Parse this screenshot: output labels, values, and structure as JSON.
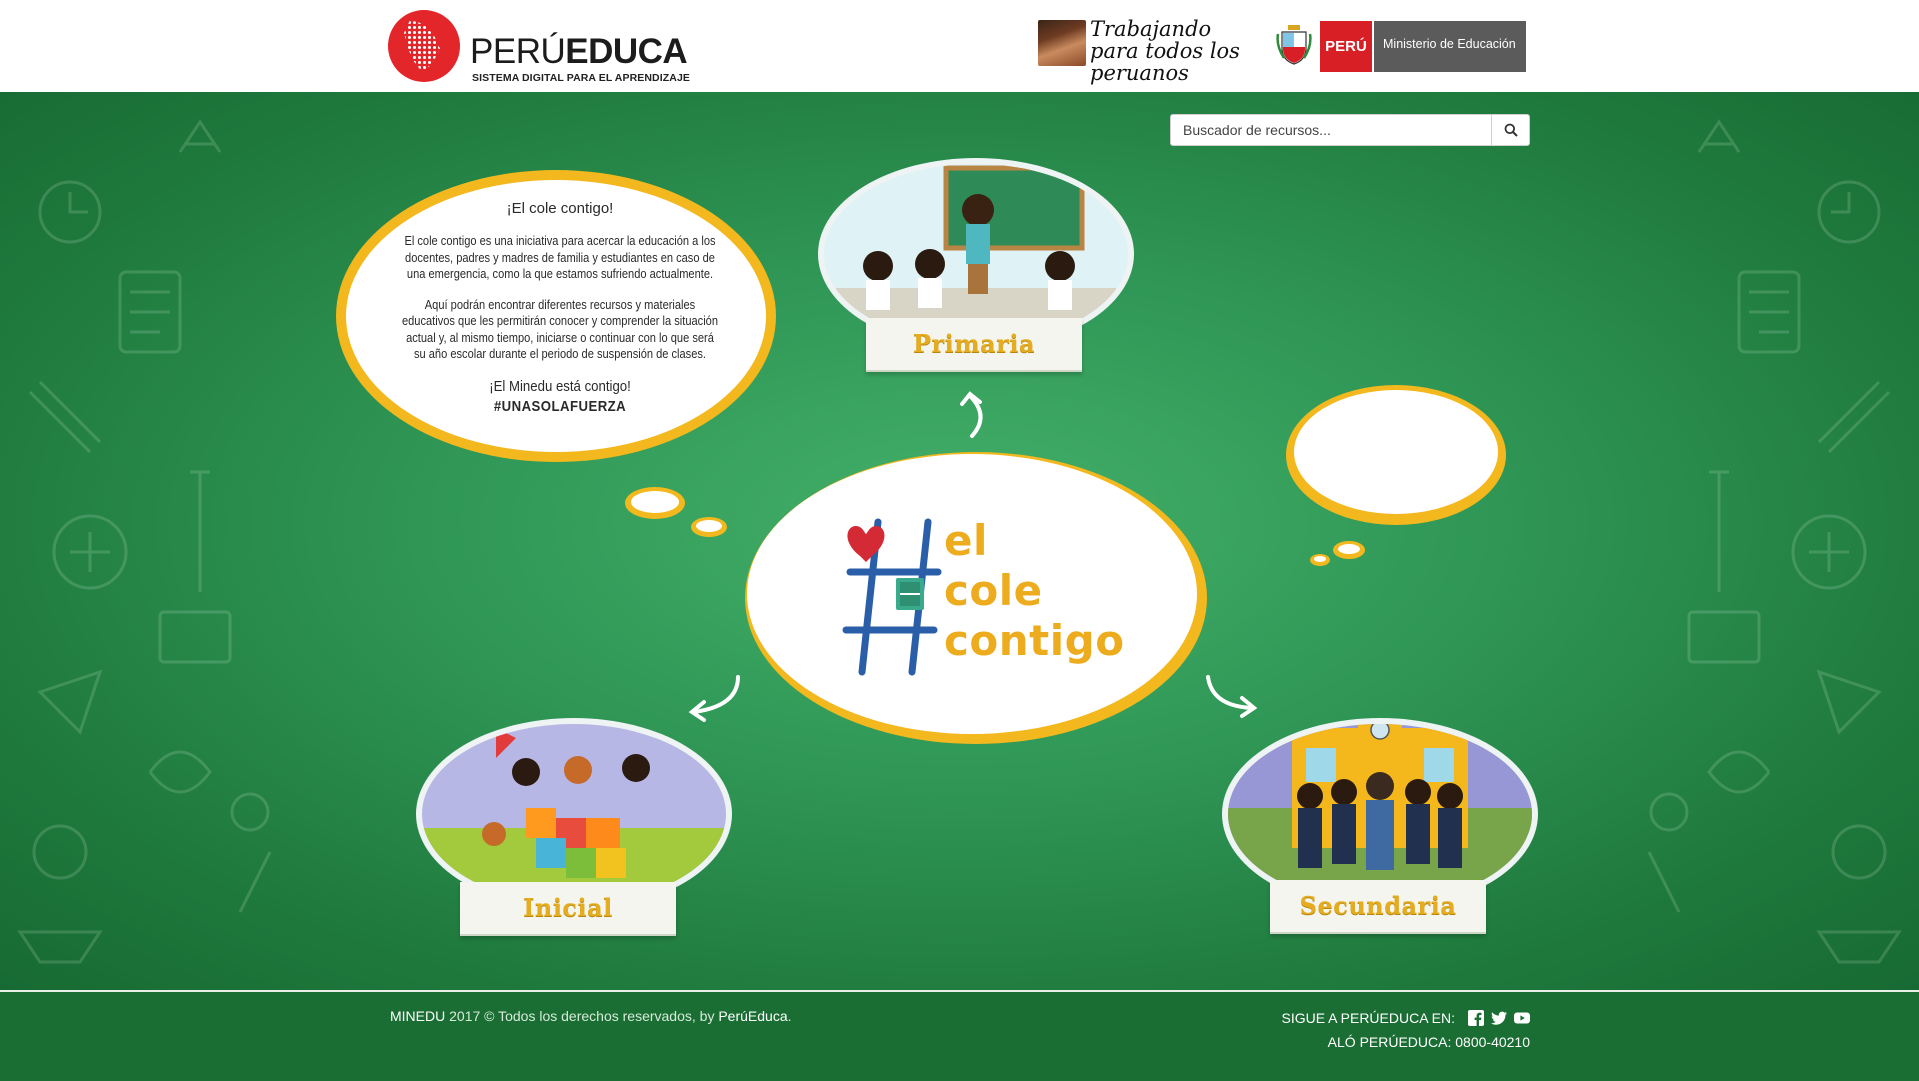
{
  "header": {
    "brand": {
      "name_light": "PERÚ",
      "name_bold": "EDUCA",
      "tagline": "SISTEMA DIGITAL PARA EL APRENDIZAJE"
    },
    "gov": {
      "slogan": "Trabajando para todos los peruanos",
      "country": "PERÚ",
      "ministry": "Ministerio de Educación"
    }
  },
  "search": {
    "placeholder": "Buscador de recursos..."
  },
  "info": {
    "title": "¡El cole contigo!",
    "paragraph1": "El cole contigo es una iniciativa para acercar la educación a los docentes, padres y madres de familia y estudiantes en caso de una emergencia, como la que estamos sufriendo actualmente.",
    "paragraph2": "Aquí podrán encontrar diferentes recursos y materiales educativos que les permitirán conocer y comprender la situación actual y, al mismo tiempo, iniciarse o continuar con lo que será su año escolar durante el periodo de suspensión de clases.",
    "closing": "¡El Minedu está contigo!",
    "hashtag": "#UNASOLAFUERZA"
  },
  "campaign": {
    "line1": "el",
    "line2": "cole",
    "line3": "contigo"
  },
  "levels": {
    "primaria": "Primaria",
    "inicial": "Inicial",
    "secundaria": "Secundaria"
  },
  "footer": {
    "org": "MINEDU",
    "copyright": " 2017 © Todos los derechos reservados, by ",
    "brand": "PerúEduca",
    "period": ".",
    "follow_label": "SIGUE A PERÚEDUCA EN:",
    "hotline": "ALÓ PERÚEDUCA: 0800-40210"
  },
  "colors": {
    "brand_red": "#e3262a",
    "board_green": "#2f9655",
    "bubble_yellow": "#f2b81e",
    "campaign_blue": "#2a5ea8",
    "footer_green": "#1a6e33"
  },
  "icons": [
    "search-icon",
    "facebook-icon",
    "twitter-icon",
    "youtube-icon",
    "heart-icon",
    "book-icon",
    "arrow-icon"
  ]
}
